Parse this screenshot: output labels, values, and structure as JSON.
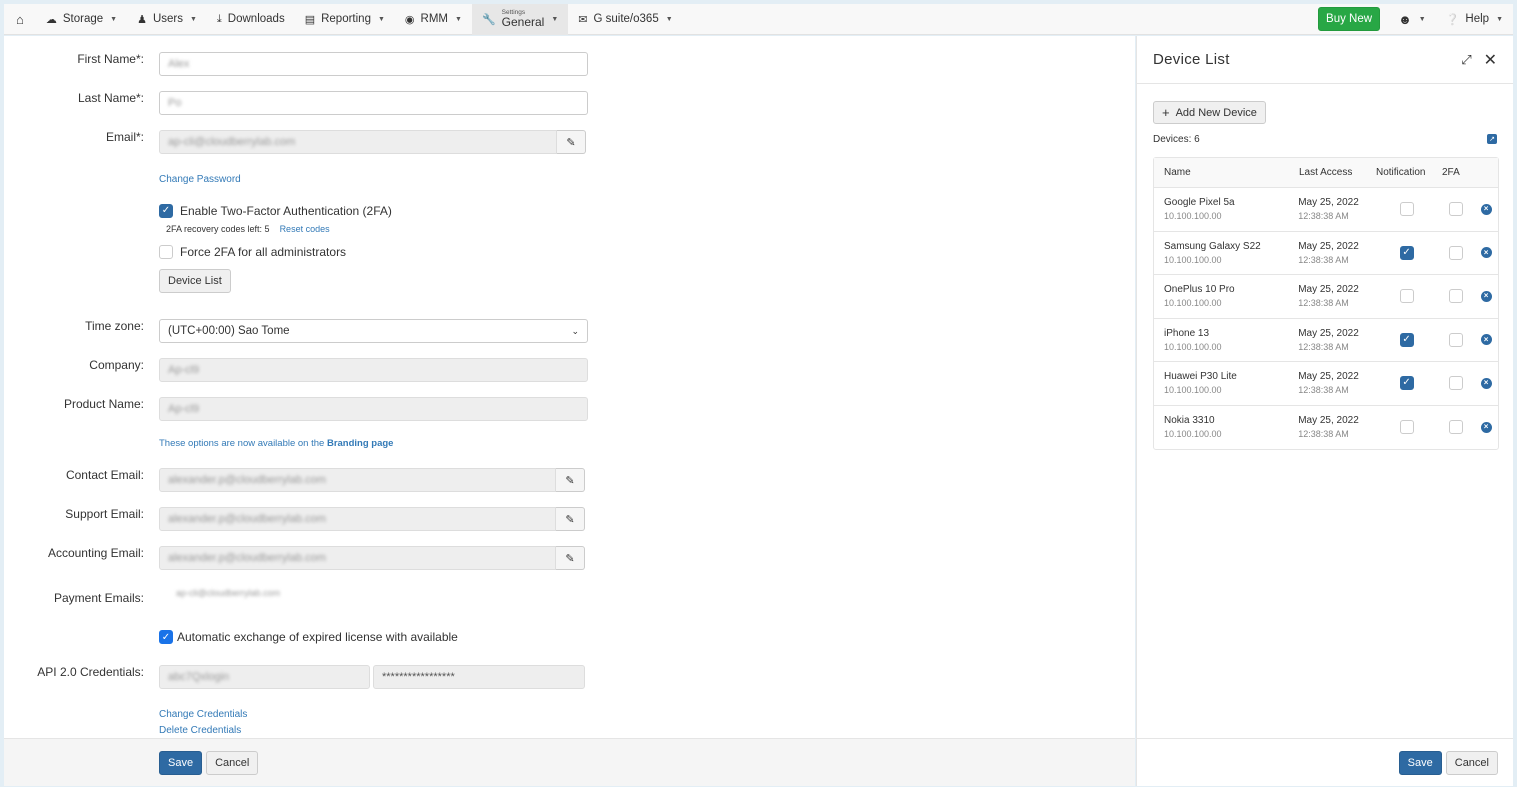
{
  "nav": {
    "items": [
      {
        "label": "Storage",
        "icon": "cloud-icon",
        "dropdown": true
      },
      {
        "label": "Users",
        "icon": "user-icon",
        "dropdown": true
      },
      {
        "label": "Downloads",
        "icon": "download-icon",
        "dropdown": false
      },
      {
        "label": "Reporting",
        "icon": "bar-chart-icon",
        "dropdown": true
      },
      {
        "label": "RMM",
        "icon": "globe-icon",
        "dropdown": true
      },
      {
        "label": "General",
        "sublabel": "Settings",
        "icon": "wrench-icon",
        "dropdown": true,
        "active": true
      },
      {
        "label": "G suite/o365",
        "icon": "envelope-icon",
        "dropdown": true
      }
    ],
    "buy_new": "Buy New",
    "help": "Help"
  },
  "form": {
    "first_name": {
      "label": "First Name*:",
      "value": "Alex"
    },
    "last_name": {
      "label": "Last Name*:",
      "value": "Po"
    },
    "email": {
      "label": "Email*:",
      "value": "ap-cli@cloudberrylab.com"
    },
    "change_password": "Change Password",
    "enable_2fa": {
      "label": "Enable Two-Factor Authentication (2FA)",
      "checked": true
    },
    "recovery_codes": "2FA recovery codes left: 5",
    "reset_codes": "Reset codes",
    "force_2fa": {
      "label": "Force 2FA for all administrators",
      "checked": false
    },
    "device_list_button": "Device List",
    "time_zone": {
      "label": "Time zone:",
      "value": "(UTC+00:00) Sao Tome"
    },
    "company": {
      "label": "Company:",
      "value": "Ap-cl9"
    },
    "product_name": {
      "label": "Product Name:",
      "value": "Ap-cl9"
    },
    "branding_note": "These options are now available on the ",
    "branding_link": "Branding page",
    "contact_email": {
      "label": "Contact Email:",
      "value": "alexander.p@cloudberrylab.com"
    },
    "support_email": {
      "label": "Support Email:",
      "value": "alexander.p@cloudberrylab.com"
    },
    "accounting_email": {
      "label": "Accounting Email:",
      "value": "alexander.p@cloudberrylab.com"
    },
    "payment_emails": {
      "label": "Payment Emails:",
      "value": "ap-cli@cloudberrylab.com"
    },
    "auto_exchange": {
      "label": "Automatic exchange of expired license with available",
      "checked": true
    },
    "api_credentials": {
      "label": "API 2.0 Credentials:",
      "login": "abc7Qxlogin",
      "password": "*****************"
    },
    "change_credentials": "Change Credentials",
    "delete_credentials": "Delete Credentials",
    "save": "Save",
    "cancel": "Cancel"
  },
  "device_panel": {
    "title": "Device List",
    "add_button": "Add New Device",
    "count_label": "Devices: 6",
    "columns": [
      "Name",
      "Last Access",
      "Notification",
      "2FA"
    ],
    "devices": [
      {
        "name": "Google Pixel 5a",
        "ip": "10.100.100.00",
        "date": "May 25, 2022",
        "time": "12:38:38 AM",
        "notification": false,
        "twofa": false
      },
      {
        "name": "Samsung Galaxy S22",
        "ip": "10.100.100.00",
        "date": "May 25, 2022",
        "time": "12:38:38 AM",
        "notification": true,
        "twofa": false
      },
      {
        "name": "OnePlus 10 Pro",
        "ip": "10.100.100.00",
        "date": "May 25, 2022",
        "time": "12:38:38 AM",
        "notification": false,
        "twofa": false
      },
      {
        "name": "iPhone 13",
        "ip": "10.100.100.00",
        "date": "May 25, 2022",
        "time": "12:38:38 AM",
        "notification": true,
        "twofa": false
      },
      {
        "name": "Huawei P30 Lite",
        "ip": "10.100.100.00",
        "date": "May 25, 2022",
        "time": "12:38:38 AM",
        "notification": true,
        "twofa": false
      },
      {
        "name": "Nokia 3310",
        "ip": "10.100.100.00",
        "date": "May 25, 2022",
        "time": "12:38:38 AM",
        "notification": false,
        "twofa": false
      }
    ],
    "save": "Save",
    "cancel": "Cancel"
  },
  "colors": {
    "primary": "#2e6aa3",
    "success": "#28a745",
    "link": "#337ab7"
  }
}
